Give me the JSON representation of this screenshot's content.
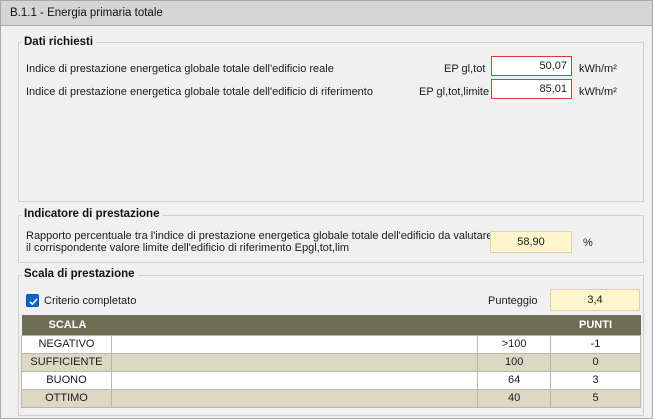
{
  "panel": {
    "title": "B.1.1 - Energia primaria totale"
  },
  "dati": {
    "title": "Dati richiesti",
    "rows": [
      {
        "label": "Indice di prestazione energetica globale totale dell'edificio reale",
        "symbol": "EP gl,tot",
        "value": "50,07",
        "unit": "kWh/m²"
      },
      {
        "label": "Indice di prestazione energetica globale totale dell'edificio di riferimento",
        "symbol": "EP gl,tot,limite",
        "value": "85,01",
        "unit": "kWh/m²"
      }
    ]
  },
  "indicatore": {
    "title": "Indicatore di prestazione",
    "line1": "Rapporto percentuale tra l'indice di prestazione energetica globale totale dell'edificio da valutare EPgl,tot e",
    "line2": "il corrispondente valore limite dell'edificio di riferimento Epgl,tot,lim",
    "value": "58,90",
    "unit": "%"
  },
  "scala": {
    "title": "Scala di prestazione",
    "checkbox_label": "Criterio completato",
    "checked": true,
    "punteggio_label": "Punteggio",
    "punteggio_value": "3,4",
    "headers": {
      "scala": "SCALA",
      "punti": "PUNTI"
    },
    "rows": [
      {
        "name": "NEGATIVO",
        "threshold": ">100",
        "points": "-1"
      },
      {
        "name": "SUFFICIENTE",
        "threshold": "100",
        "points": "0"
      },
      {
        "name": "BUONO",
        "threshold": "64",
        "points": "3"
      },
      {
        "name": "OTTIMO",
        "threshold": "40",
        "points": "5"
      }
    ]
  },
  "colors": {
    "title_bar": "#d5d5d5",
    "input_border": "#d93a3a",
    "readout_bg": "#fff6cc",
    "table_header": "#6e6e55",
    "row_alt": "#dcd8c4",
    "checkbox": "#0a66c8"
  },
  "icons": {
    "checkbox": "checkmark-icon"
  }
}
